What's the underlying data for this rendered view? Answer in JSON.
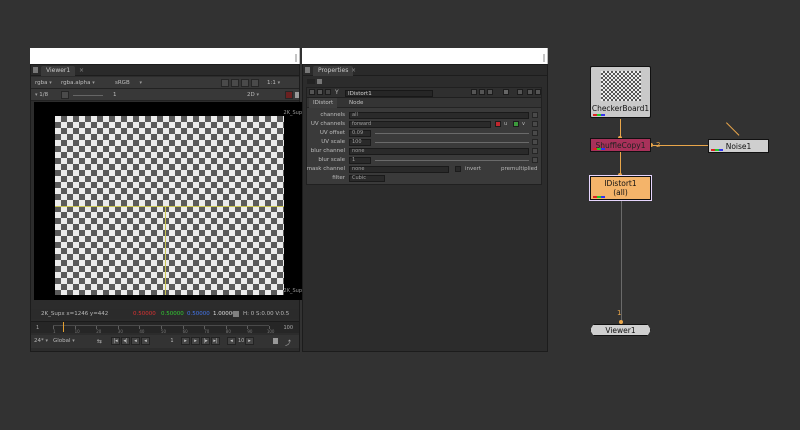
{
  "viewer": {
    "tab_label": "Viewer1",
    "channels": "rgba",
    "alpha": "rgba.alpha",
    "colorspace": "sRGB",
    "zoom": "1:1",
    "input_a": "1/8",
    "input_b": "1",
    "view_mode": "2D",
    "format_top": "2K_Sup",
    "format_bottom": "2K_Sup",
    "status_format": "2K_Supx x=1246 y=442",
    "pixel_r": "0.50000",
    "pixel_g": "0.50000",
    "pixel_b": "0.50000",
    "pixel_a": "1.00000",
    "pixel_info": "H: 0 S:0.00 V:0.5",
    "frame_rate": "24*",
    "range_mode": "Global",
    "current_frame": "1",
    "increment": "10",
    "end_frame": "100",
    "timeline_ticks": [
      "1",
      "10",
      "20",
      "30",
      "40",
      "50",
      "60",
      "70",
      "80",
      "90",
      "100"
    ]
  },
  "properties": {
    "tab_label": "Properties",
    "node_name": "IDistort1",
    "tabs": [
      "IDistort",
      "Node"
    ],
    "knobs": [
      {
        "label": "channels",
        "value": "all"
      },
      {
        "label": "UV channels",
        "value": "forward"
      },
      {
        "label": "UV offset",
        "value": "0.09"
      },
      {
        "label": "UV scale",
        "value": "100"
      },
      {
        "label": "blur channel",
        "value": "none"
      },
      {
        "label": "blur scale",
        "value": "1"
      },
      {
        "label": "mask channel",
        "value": "none",
        "invert": "invert",
        "premult": "premultiplied"
      },
      {
        "label": "filter",
        "value": "Cubic"
      }
    ],
    "uv_suffix_u": "u",
    "uv_suffix_v": "v"
  },
  "graph": {
    "checkerboard": "CheckerBoard1",
    "shuffle": "ShuffleCopy1",
    "noise": "Noise1",
    "idistort_line1": "IDistort1",
    "idistort_line2": "(all)",
    "viewer": "Viewer1",
    "input_2": "2",
    "input_1": "1",
    "colors": {
      "wire": "#e9a64a",
      "shuffle": "#a8315a",
      "idistort": "#f4b46a",
      "noise": "#cfcfcf"
    }
  }
}
